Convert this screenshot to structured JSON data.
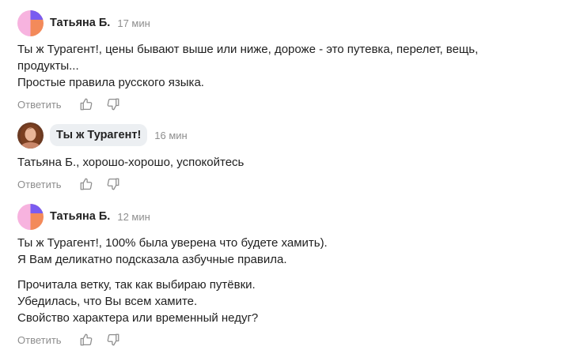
{
  "comments": [
    {
      "author": "Татьяна Б.",
      "time": "17 мин",
      "lines": [
        "Ты ж Турагент!, цены бывают выше или ниже, дороже - это путевка, перелет, вещь,",
        "продукты...",
        "Простые правила русского языка."
      ],
      "reply_label": "Ответить",
      "avatar": "split-pink-orange-avatar"
    },
    {
      "author": "Ты ж Турагент!",
      "time": "16 мин",
      "lines": [
        "Татьяна Б., хорошо-хорошо, успокойтесь"
      ],
      "reply_label": "Ответить",
      "avatar": "photo-avatar"
    },
    {
      "author": "Татьяна Б.",
      "time": "12 мин",
      "paragraph1": [
        "Ты ж Турагент!, 100% была уверена что будете хамить).",
        "Я Вам деликатно подсказала азбучные правила."
      ],
      "paragraph2": [
        "Прочитала ветку, так как выбираю путёвки.",
        "Убедилась, что Вы всем хамите.",
        "Свойство характера или временный недуг?"
      ],
      "reply_label": "Ответить",
      "avatar": "split-pink-orange-avatar"
    }
  ],
  "icons": {
    "like": "thumbs-up-icon",
    "dislike": "thumbs-down-icon"
  },
  "colors": {
    "avatar_pink": "#f7b3df",
    "avatar_orange": "#f38a5a",
    "avatar_purple": "#7a5cf0",
    "muted": "#8e8e8e",
    "chip_bg": "#eceff2"
  }
}
